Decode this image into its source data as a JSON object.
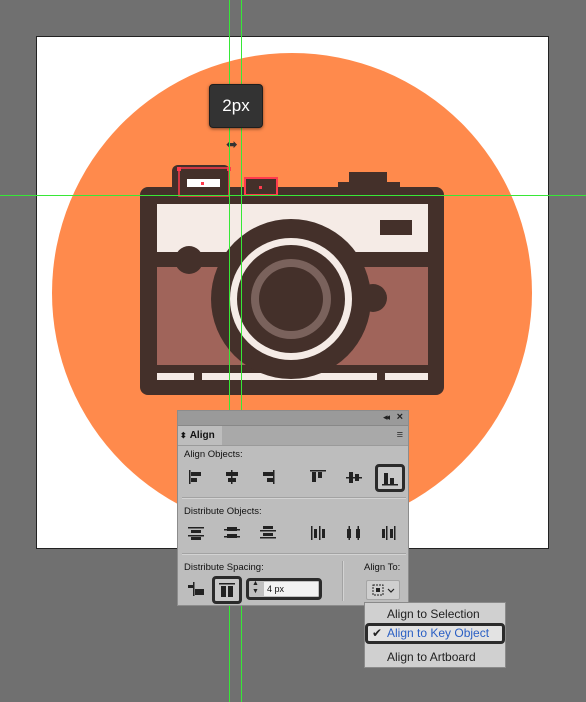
{
  "tooltip": {
    "text": "2px"
  },
  "panel": {
    "title": "Align",
    "align_objects_label": "Align Objects:",
    "distribute_objects_label": "Distribute Objects:",
    "distribute_spacing_label": "Distribute Spacing:",
    "align_to_label": "Align To:",
    "spacing_value": "4 px",
    "icons": {
      "collapse": "double-chevron-icon",
      "close": "close-icon",
      "menu": "hamburger-menu-icon"
    }
  },
  "dropdown": {
    "items": [
      {
        "label": "Align to Selection",
        "checked": false
      },
      {
        "label": "Align to Key Object",
        "checked": true
      },
      {
        "label": "Align to Artboard",
        "checked": false
      }
    ]
  },
  "colors": {
    "workspace": "#707070",
    "artboard": "#ffffff",
    "circle": "#ff8a4c",
    "camera_dark": "#44302a",
    "camera_light": "#f5ebe6",
    "camera_mid": "#a0645a",
    "lens_ring": "#7a625c",
    "guide": "#37e837",
    "selection": "#ff3b4d",
    "checked_item": "#2a5fc4"
  }
}
